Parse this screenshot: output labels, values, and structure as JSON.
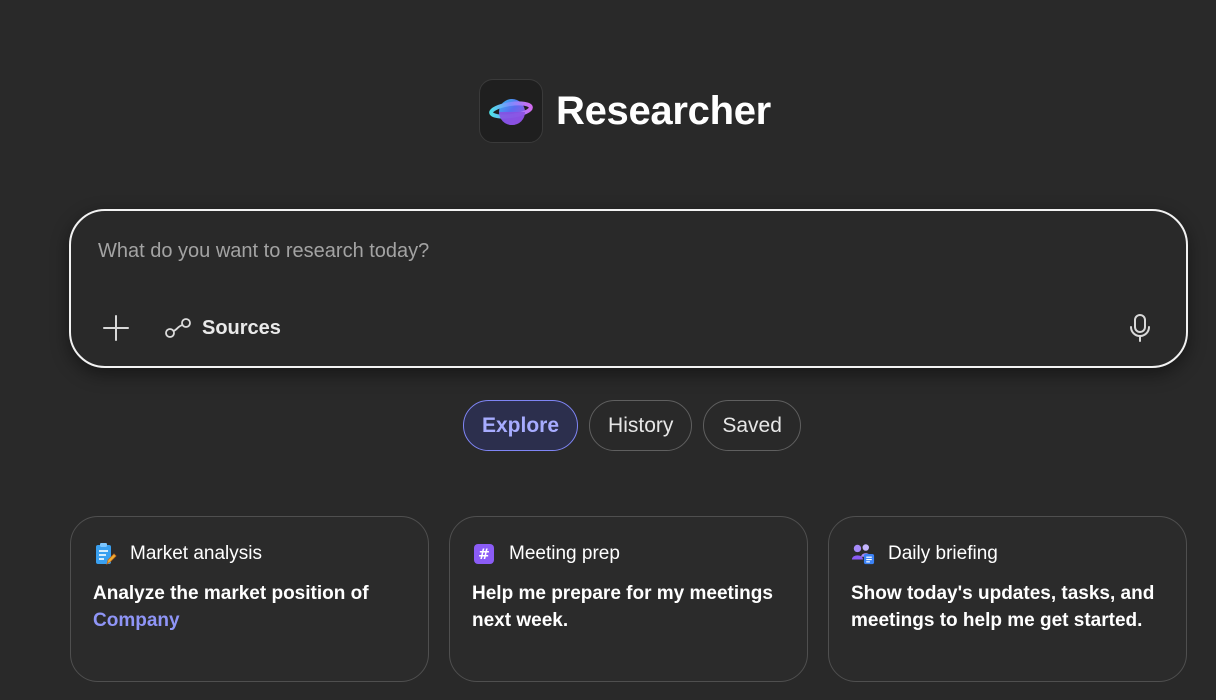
{
  "app": {
    "title": "Researcher",
    "logo_icon": "researcher-planet-icon"
  },
  "composer": {
    "placeholder": "What do you want to research today?",
    "value": "",
    "add_icon": "plus-icon",
    "sources_icon": "link-nodes-icon",
    "sources_label": "Sources",
    "mic_icon": "microphone-icon"
  },
  "tabs": [
    {
      "label": "Explore",
      "active": true
    },
    {
      "label": "History",
      "active": false
    },
    {
      "label": "Saved",
      "active": false
    }
  ],
  "cards": [
    {
      "icon": "clipboard-pencil-icon",
      "title": "Market analysis",
      "body": "Analyze the market position of",
      "highlight": "Company"
    },
    {
      "icon": "hashtag-icon",
      "title": "Meeting prep",
      "body": "Help me prepare for my meetings next week.",
      "highlight": ""
    },
    {
      "icon": "people-list-icon",
      "title": "Daily briefing",
      "body": "Show today's updates, tasks, and meetings to help me get started.",
      "highlight": ""
    }
  ],
  "colors": {
    "background": "#292929",
    "accent": "#7f85f5",
    "highlight_text": "#8f95f7",
    "composer_border": "#f2f2f2"
  }
}
